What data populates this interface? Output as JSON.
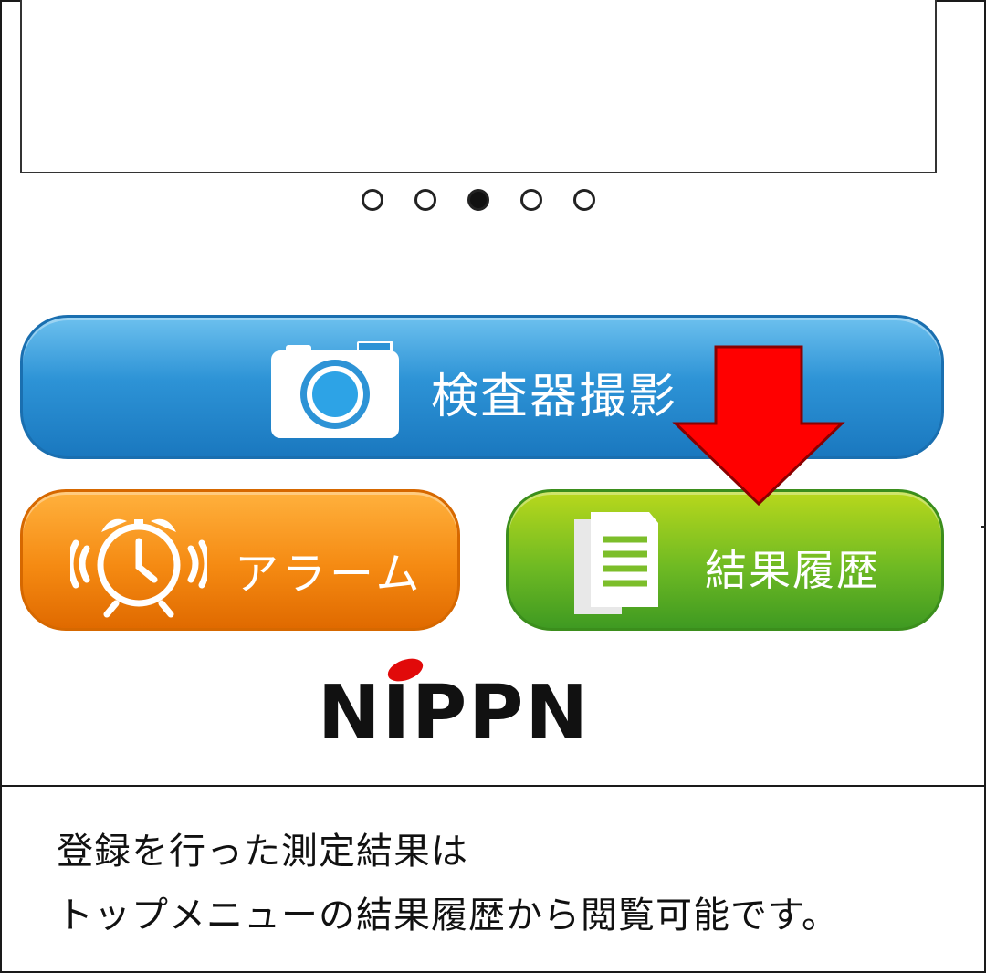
{
  "carousel": {
    "page_count": 5,
    "active_index": 2
  },
  "buttons": {
    "camera": {
      "label": "検査器撮影",
      "icon": "camera-icon",
      "color": "#2d93d6"
    },
    "alarm": {
      "label": "アラーム",
      "icon": "alarm-clock-icon",
      "color": "#f58a12"
    },
    "history": {
      "label": "結果履歴",
      "icon": "document-icon",
      "color": "#6fba23"
    }
  },
  "logo": {
    "text": "NIPPN",
    "dot_color": "#e10a0a"
  },
  "annotation": {
    "arrow_color": "#ff0000",
    "arrow_icon": "arrow-down-icon"
  },
  "caption": {
    "line1": "登録を行った測定結果は",
    "line2": "トップメニューの結果履歴から閲覧可能です。"
  }
}
